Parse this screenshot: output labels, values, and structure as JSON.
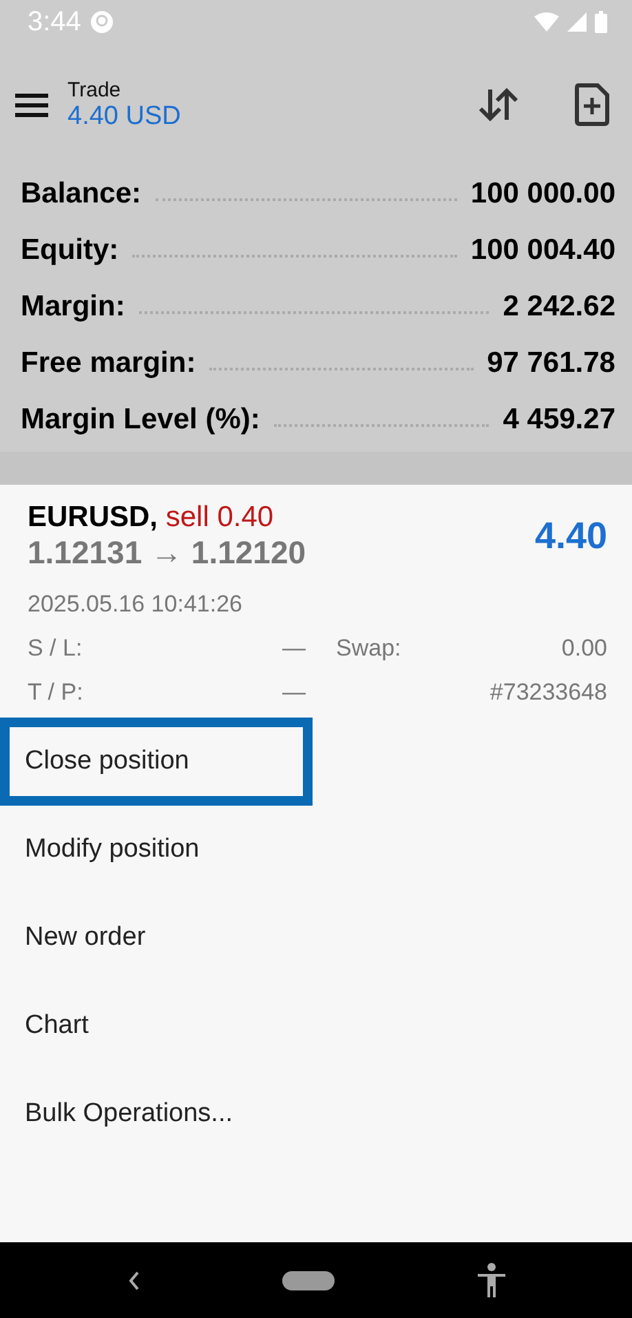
{
  "status_bar": {
    "time": "3:44"
  },
  "toolbar": {
    "title": "Trade",
    "profit": "4.40 USD"
  },
  "account": [
    {
      "label": "Balance:",
      "value": "100 000.00"
    },
    {
      "label": "Equity:",
      "value": "100 004.40"
    },
    {
      "label": "Margin:",
      "value": "2 242.62"
    },
    {
      "label": "Free margin:",
      "value": "97 761.78"
    },
    {
      "label": "Margin Level (%):",
      "value": "4 459.27"
    }
  ],
  "position": {
    "symbol": "EURUSD,",
    "side": "sell 0.40",
    "prices": "1.12131 → 1.12120",
    "profit": "4.40",
    "time": "2025.05.16 10:41:26",
    "sl_label": "S / L:",
    "sl": "—",
    "swap_label": "Swap:",
    "swap": "0.00",
    "tp_label": "T / P:",
    "tp": "—",
    "ticket": "#73233648"
  },
  "menu": [
    {
      "label": "Close position",
      "selected": true
    },
    {
      "label": "Modify position",
      "selected": false
    },
    {
      "label": "New order",
      "selected": false
    },
    {
      "label": "Chart",
      "selected": false
    },
    {
      "label": "Bulk Operations...",
      "selected": false
    }
  ]
}
